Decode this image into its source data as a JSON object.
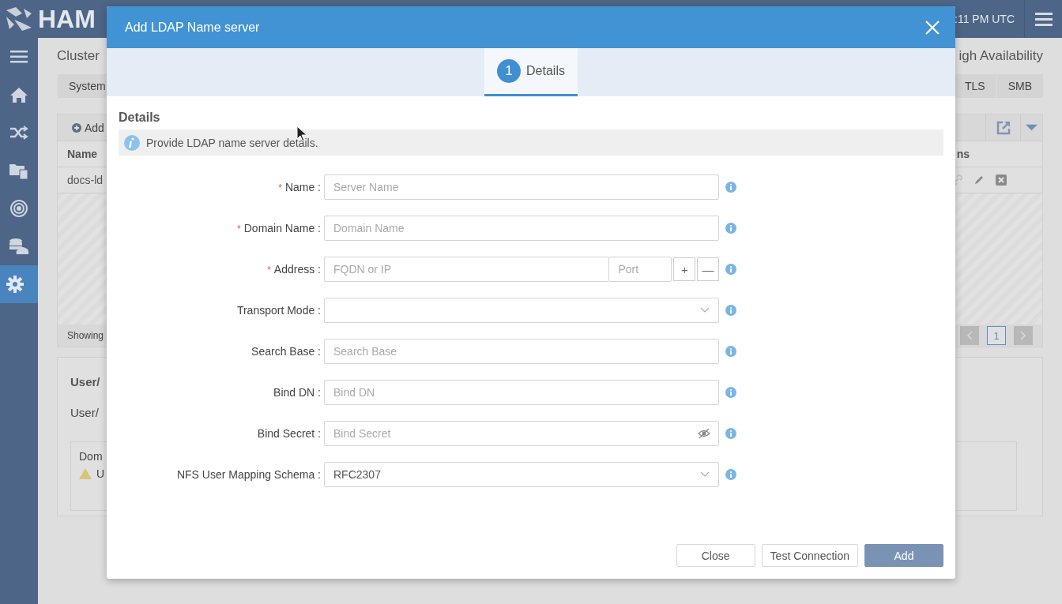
{
  "header": {
    "logo_text": "HAM",
    "clock": ":11 PM UTC"
  },
  "sidebar": {
    "items": [
      {
        "kind": "menu",
        "selected": false
      },
      {
        "kind": "home",
        "selected": false
      },
      {
        "kind": "shuffle",
        "selected": false
      },
      {
        "kind": "folders",
        "selected": false
      },
      {
        "kind": "target",
        "selected": false
      },
      {
        "kind": "storage",
        "selected": false
      },
      {
        "kind": "settings",
        "selected": true
      }
    ]
  },
  "page": {
    "title": "Cluster",
    "title_right": "igh Availability",
    "tabs": [
      {
        "label": "System"
      },
      {
        "label": "TLS"
      },
      {
        "label": "SMB"
      }
    ],
    "table": {
      "add_button": "Add",
      "columns": [
        "Name",
        "ns"
      ],
      "rows": [
        [
          "docs-ld"
        ]
      ],
      "footer": "Showing",
      "page": "1"
    },
    "section": {
      "title": "User/",
      "label": "User/",
      "box_title": "Dom",
      "box_text": "U"
    }
  },
  "dialog": {
    "title": "Add LDAP Name server",
    "steps": [
      {
        "number": "1",
        "label": "Details",
        "selected": true
      }
    ],
    "section_title": "Details",
    "info": "Provide LDAP name server details.",
    "fields": [
      {
        "kind": "text",
        "required_mark": "*",
        "label": "Name :",
        "placeholder": "Server Name"
      },
      {
        "kind": "text",
        "required_mark": "*",
        "label": "Domain Name :",
        "placeholder": "Domain Name"
      },
      {
        "kind": "address",
        "required_mark": "*",
        "label": "Address :",
        "placeholder": "FQDN or IP",
        "port_placeholder": "Port",
        "add": "+",
        "remove": "—"
      },
      {
        "kind": "select",
        "label": "Transport Mode :"
      },
      {
        "kind": "text",
        "label": "Search Base :",
        "placeholder": "Search Base"
      },
      {
        "kind": "text",
        "label": "Bind DN :",
        "placeholder": "Bind DN"
      },
      {
        "kind": "secret",
        "label": "Bind Secret :",
        "placeholder": "Bind Secret"
      },
      {
        "kind": "select",
        "label": "NFS User Mapping Schema :",
        "value": "RFC2307"
      }
    ],
    "buttons": [
      {
        "label": "Close",
        "kind": "secondary"
      },
      {
        "label": "Test Connection",
        "kind": "secondary"
      },
      {
        "label": "Add",
        "kind": "primary"
      }
    ]
  }
}
